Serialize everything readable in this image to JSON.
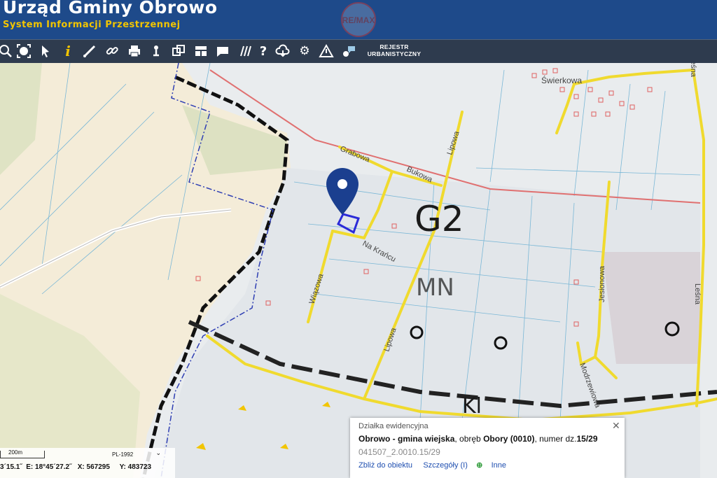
{
  "header": {
    "title": "Urząd Gminy Obrowo",
    "subtitle": "System Informacji Przestrzennej",
    "logo_text": "RE/MAX"
  },
  "toolbar": {
    "tools": [
      "zoom-icon",
      "full-extent-icon",
      "pointer-icon",
      "info-icon",
      "measure-icon",
      "link-icon",
      "print-icon",
      "locate-icon",
      "layers-icon",
      "layout-icon",
      "comment-icon",
      "hatch-icon",
      "help-icon",
      "cloud-download-icon",
      "settings-icon",
      "warning-icon",
      "user-chat-icon"
    ],
    "rejestr_label_1": "REJESTR",
    "rejestr_label_2": "URBANISTYCZNY"
  },
  "map": {
    "labels": {
      "swierkowa": "Świerkowa",
      "grabowa": "Grabowa",
      "bukowa": "Bukowa",
      "lipowa_n": "Lipowa",
      "lipowa_s": "Lipowa",
      "na_krancu": "Na Krańcu",
      "wiazowa": "Wiązowa",
      "lesna": "Leśna",
      "jesionowa": "Jesionowa",
      "modrzewiowa": "Modrzewiowa",
      "g2": "G2",
      "mn": "MN",
      "kl": "Kl"
    },
    "accent_colors": {
      "road": "#f0da2e",
      "parcel": "#2b2bd8",
      "marker": "#1b3f8f",
      "boundary": "#2f3fb3"
    }
  },
  "popup": {
    "title": "Działka ewidencyjna",
    "bold1": "Obrowo - gmina wiejska",
    "t1": ", obręb ",
    "bold2": "Obory (0010)",
    "t2": ", numer dz.",
    "bold3": "15/29",
    "id": "041507_2.0010.15/29",
    "link_zoom": "Zbliż do obiektu",
    "link_details": "Szczegóły (I)",
    "link_more": "Inne"
  },
  "status": {
    "scale": "200m",
    "crs": "PL-1992",
    "lat": "3´15.1˝",
    "e": "E: 18°45´27.2˝",
    "x": "X: 567295",
    "y": "Y: 483723"
  }
}
